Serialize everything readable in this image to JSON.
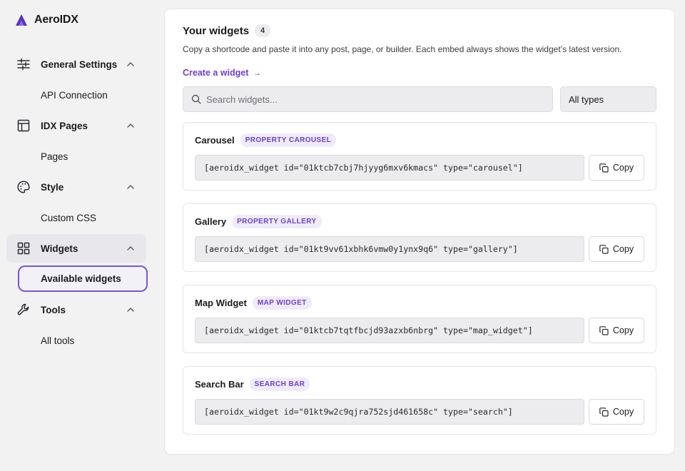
{
  "brand": {
    "name": "AeroIDX",
    "color": "#6d3fd2"
  },
  "sidebar": {
    "sections": [
      {
        "label": "General Settings",
        "icon": "sliders-icon",
        "sub": "API Connection"
      },
      {
        "label": "IDX Pages",
        "icon": "layout-icon",
        "sub": "Pages"
      },
      {
        "label": "Style",
        "icon": "palette-icon",
        "sub": "Custom CSS"
      },
      {
        "label": "Widgets",
        "icon": "grid-icon",
        "sub": "Available widgets",
        "active": true
      },
      {
        "label": "Tools",
        "icon": "wrench-icon",
        "sub": "All tools"
      }
    ]
  },
  "main": {
    "title": "Your widgets",
    "count": "4",
    "subtitle": "Copy a shortcode and paste it into any post, page, or builder. Each embed always shows the widget’s latest version.",
    "create_link": "Create a widget",
    "search_placeholder": "Search widgets...",
    "type_filter": "All types",
    "copy_label": "Copy"
  },
  "widgets": [
    {
      "name": "Carousel",
      "type": "PROPERTY CAROUSEL",
      "shortcode": "[aeroidx_widget id=\"01ktcb7cbj7hjyyg6mxv6kmacs\" type=\"carousel\"]"
    },
    {
      "name": "Gallery",
      "type": "PROPERTY GALLERY",
      "shortcode": "[aeroidx_widget id=\"01kt9vv61xbhk6vmw0y1ynx9q6\" type=\"gallery\"]"
    },
    {
      "name": "Map Widget",
      "type": "MAP WIDGET",
      "shortcode": "[aeroidx_widget id=\"01ktcb7tqtfbcjd93azxb6nbrg\" type=\"map_widget\"]"
    },
    {
      "name": "Search Bar",
      "type": "SEARCH BAR",
      "shortcode": "[aeroidx_widget id=\"01kt9w2c9qjra752sjd461658c\" type=\"search\"]"
    }
  ]
}
